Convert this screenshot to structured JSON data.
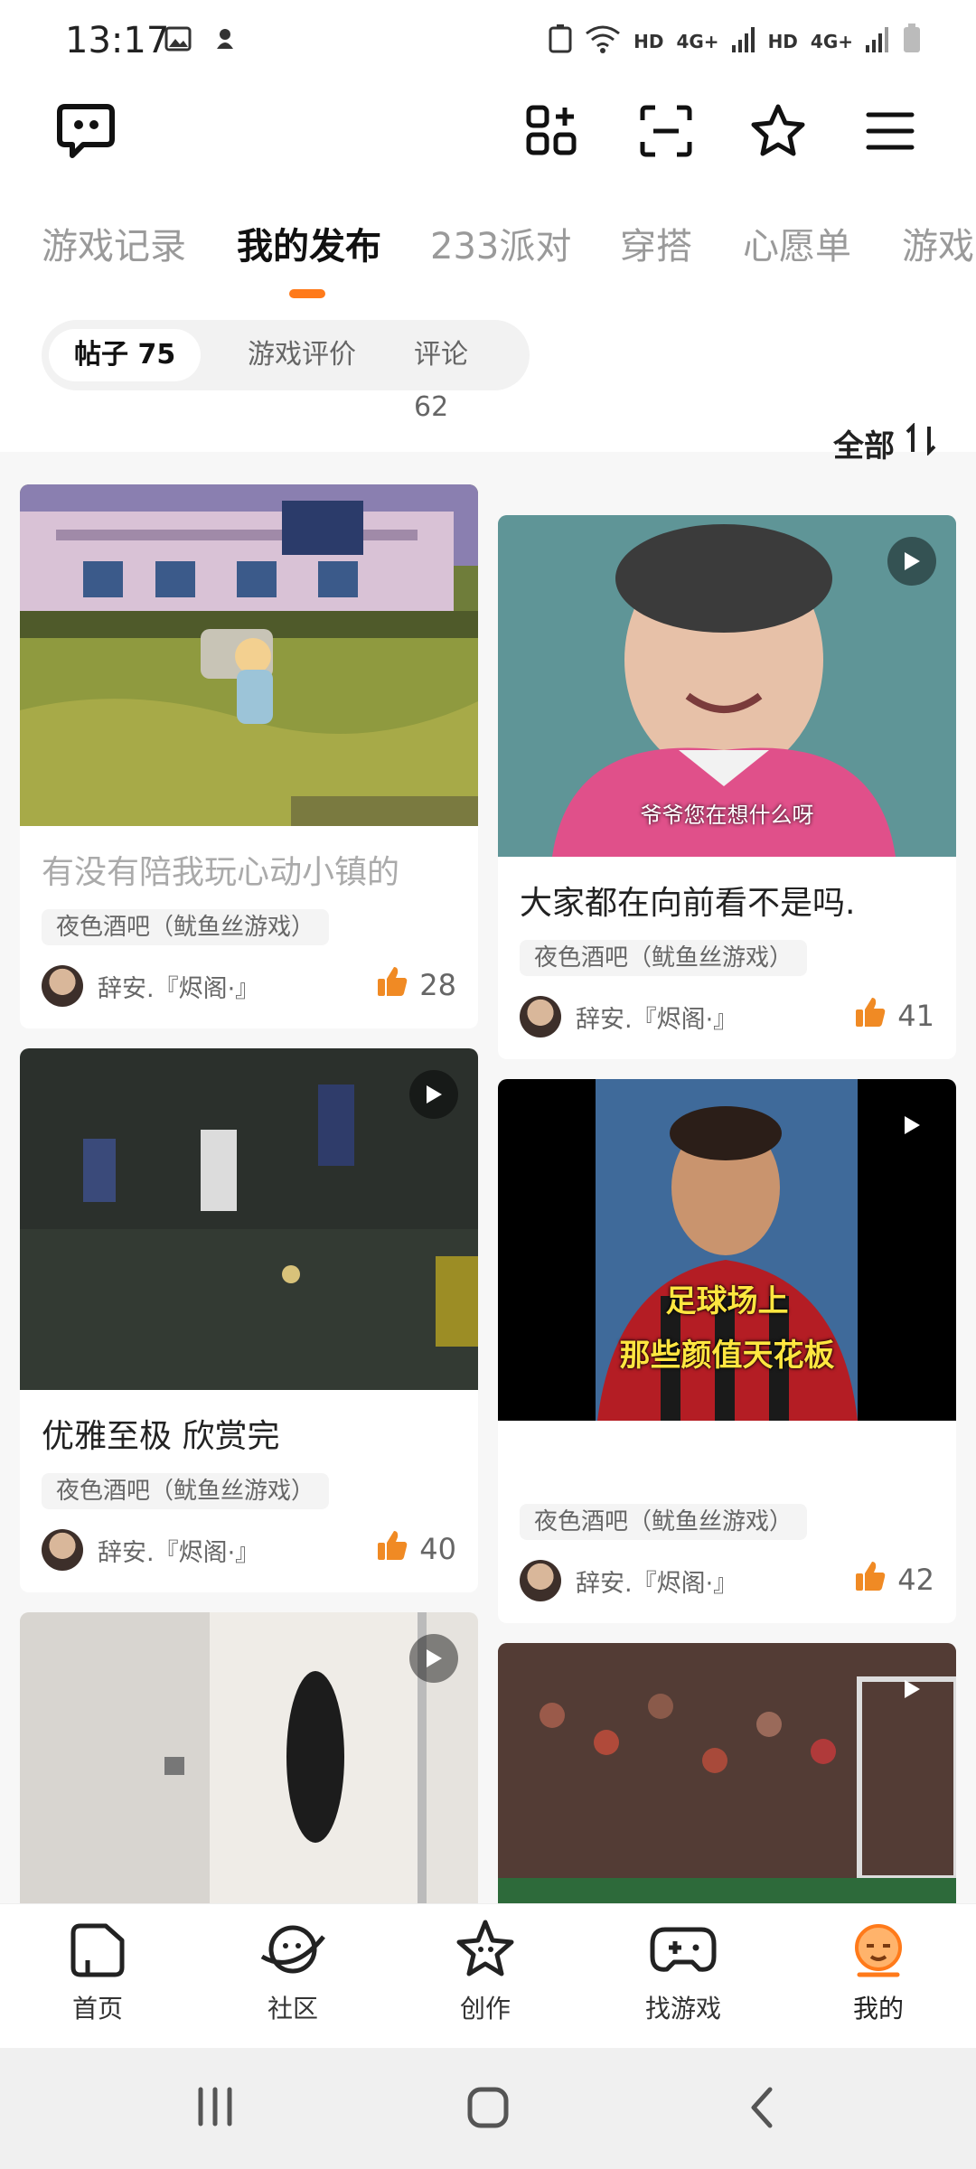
{
  "status": {
    "time": "13:17",
    "hd1": "HD",
    "net1": "4G+",
    "hd2": "HD",
    "net2": "4G+"
  },
  "tabs": [
    "游戏记录",
    "我的发布",
    "233派对",
    "穿搭",
    "心愿单",
    "游戏"
  ],
  "active_tab": "我的发布",
  "subtabs": [
    "帖子 75",
    "游戏评价",
    "评论 62"
  ],
  "sort_label": "全部",
  "posts": [
    {
      "title": "有没有陪我玩心动小镇的",
      "tag": "夜色酒吧（鱿鱼丝游戏）",
      "author": "辞安.『烬阁·』",
      "likes": "28"
    },
    {
      "title": "大家都在向前看不是吗.",
      "tag": "夜色酒吧（鱿鱼丝游戏）",
      "author": "辞安.『烬阁·』",
      "likes": "41",
      "caption": "爷爷您在想什么呀"
    },
    {
      "title": "优雅至极   欣赏完",
      "tag": "夜色酒吧（鱿鱼丝游戏）",
      "author": "辞安.『烬阁·』",
      "likes": "40"
    },
    {
      "title": "",
      "tag": "夜色酒吧（鱿鱼丝游戏）",
      "author": "辞安.『烬阁·』",
      "likes": "42",
      "caption_line1": "足球场上",
      "caption_line2": "那些颜值天花板"
    }
  ],
  "bottom_nav": [
    {
      "label": "首页",
      "icon": "home-icon"
    },
    {
      "label": "社区",
      "icon": "planet-icon"
    },
    {
      "label": "创作",
      "icon": "star-icon"
    },
    {
      "label": "找游戏",
      "icon": "gamepad-icon"
    },
    {
      "label": "我的",
      "icon": "profile-icon"
    }
  ],
  "colors": {
    "accent": "#ff7a1a",
    "like": "#f08a24"
  }
}
